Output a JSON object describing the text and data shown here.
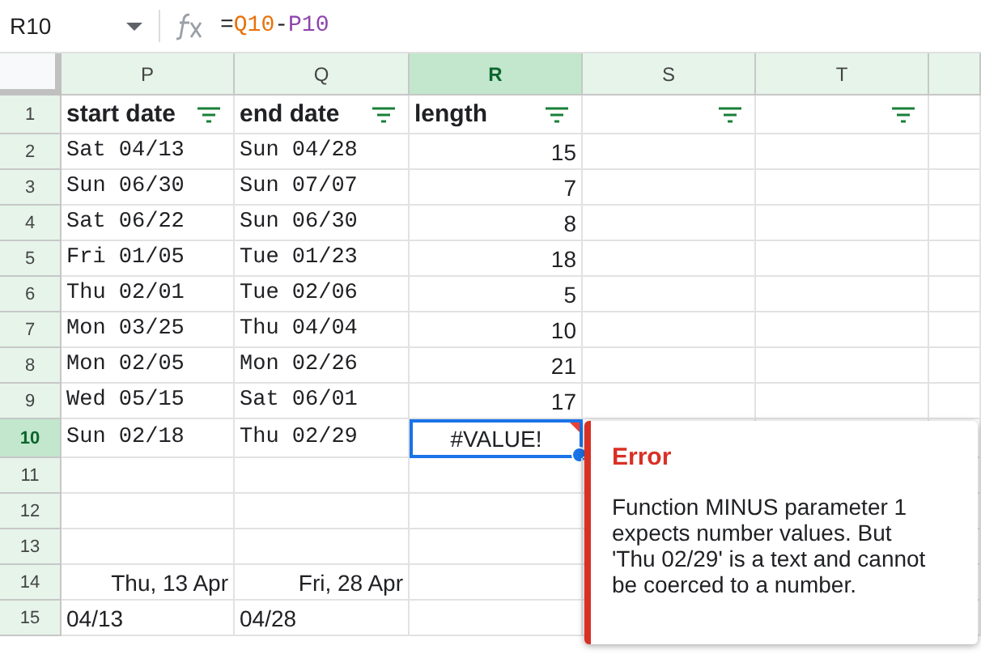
{
  "formula_bar": {
    "name_box": "R10",
    "formula": [
      {
        "text": "=",
        "color": "#202124"
      },
      {
        "text": "Q10",
        "color": "#e8710a"
      },
      {
        "text": "-",
        "color": "#202124"
      },
      {
        "text": "P10",
        "color": "#8e44ad"
      }
    ]
  },
  "columns": [
    {
      "label": "P",
      "selected": false
    },
    {
      "label": "Q",
      "selected": false
    },
    {
      "label": "R",
      "selected": true
    },
    {
      "label": "S",
      "selected": false
    },
    {
      "label": "T",
      "selected": false
    }
  ],
  "rows": [
    {
      "number": "1",
      "selected": false,
      "cells": [
        {
          "text": "start date",
          "kind": "header",
          "filter": true
        },
        {
          "text": "end date",
          "kind": "header",
          "filter": true
        },
        {
          "text": "length",
          "kind": "header",
          "filter": true
        },
        {
          "kind": "header",
          "filter": true
        },
        {
          "kind": "header",
          "filter": true
        }
      ]
    },
    {
      "number": "2",
      "selected": false,
      "cells": [
        {
          "text": "Sat 04/13",
          "kind": "mono"
        },
        {
          "text": "Sun 04/28",
          "kind": "mono"
        },
        {
          "text": "15",
          "kind": "number"
        },
        {},
        {}
      ]
    },
    {
      "number": "3",
      "selected": false,
      "cells": [
        {
          "text": "Sun 06/30",
          "kind": "mono"
        },
        {
          "text": "Sun 07/07",
          "kind": "mono"
        },
        {
          "text": "7",
          "kind": "number"
        },
        {},
        {}
      ]
    },
    {
      "number": "4",
      "selected": false,
      "cells": [
        {
          "text": "Sat 06/22",
          "kind": "mono"
        },
        {
          "text": "Sun 06/30",
          "kind": "mono"
        },
        {
          "text": "8",
          "kind": "number"
        },
        {},
        {}
      ]
    },
    {
      "number": "5",
      "selected": false,
      "cells": [
        {
          "text": "Fri 01/05",
          "kind": "mono"
        },
        {
          "text": "Tue 01/23",
          "kind": "mono"
        },
        {
          "text": "18",
          "kind": "number"
        },
        {},
        {}
      ]
    },
    {
      "number": "6",
      "selected": false,
      "cells": [
        {
          "text": "Thu 02/01",
          "kind": "mono"
        },
        {
          "text": "Tue 02/06",
          "kind": "mono"
        },
        {
          "text": "5",
          "kind": "number"
        },
        {},
        {}
      ]
    },
    {
      "number": "7",
      "selected": false,
      "cells": [
        {
          "text": "Mon 03/25",
          "kind": "mono"
        },
        {
          "text": "Thu 04/04",
          "kind": "mono"
        },
        {
          "text": "10",
          "kind": "number"
        },
        {},
        {}
      ]
    },
    {
      "number": "8",
      "selected": false,
      "cells": [
        {
          "text": "Mon 02/05",
          "kind": "mono"
        },
        {
          "text": "Mon 02/26",
          "kind": "mono"
        },
        {
          "text": "21",
          "kind": "number"
        },
        {},
        {}
      ]
    },
    {
      "number": "9",
      "selected": false,
      "cells": [
        {
          "text": "Wed 05/15",
          "kind": "mono"
        },
        {
          "text": "Sat 06/01",
          "kind": "mono"
        },
        {
          "text": "17",
          "kind": "number"
        },
        {},
        {}
      ]
    },
    {
      "number": "10",
      "selected": true,
      "cells": [
        {
          "text": "Sun 02/18",
          "kind": "mono"
        },
        {
          "text": "Thu 02/29",
          "kind": "mono"
        },
        {
          "text": "#VALUE!",
          "kind": "error"
        },
        {},
        {}
      ]
    },
    {
      "number": "11",
      "selected": false,
      "cells": [
        {},
        {},
        {},
        {},
        {}
      ]
    },
    {
      "number": "12",
      "selected": false,
      "cells": [
        {},
        {},
        {},
        {},
        {}
      ]
    },
    {
      "number": "13",
      "selected": false,
      "cells": [
        {},
        {},
        {},
        {},
        {}
      ]
    },
    {
      "number": "14",
      "selected": false,
      "cells": [
        {
          "text": "Thu, 13 Apr",
          "kind": "date"
        },
        {
          "text": "Fri, 28 Apr",
          "kind": "date"
        },
        {},
        {},
        {}
      ]
    },
    {
      "number": "15",
      "selected": false,
      "cells": [
        {
          "text": "04/13",
          "kind": "text"
        },
        {
          "text": "04/28",
          "kind": "text"
        },
        {},
        {},
        {}
      ]
    }
  ],
  "error_popup": {
    "title": "Error",
    "message": "Function MINUS parameter 1 expects number values. But 'Thu 02/29' is a text and cannot be coerced to a number."
  }
}
